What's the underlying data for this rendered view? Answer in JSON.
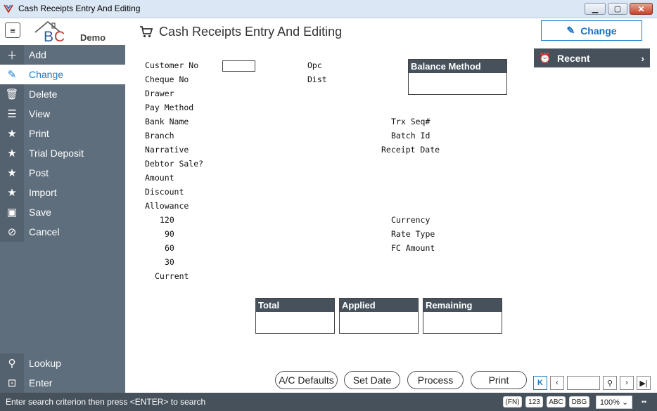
{
  "window": {
    "title": "Cash Receipts Entry And Editing"
  },
  "header": {
    "logo_demo": "Demo",
    "page_title": "Cash Receipts Entry And Editing",
    "mode_button": "Change"
  },
  "sidebar": {
    "items": [
      {
        "label": "Add",
        "icon": "plus-icon"
      },
      {
        "label": "Change",
        "icon": "pencil-icon"
      },
      {
        "label": "Delete",
        "icon": "trash-icon"
      },
      {
        "label": "View",
        "icon": "list-icon"
      },
      {
        "label": "Print",
        "icon": "star-icon"
      },
      {
        "label": "Trial Deposit",
        "icon": "star-icon"
      },
      {
        "label": "Post",
        "icon": "star-icon"
      },
      {
        "label": "Import",
        "icon": "star-icon"
      },
      {
        "label": "Save",
        "icon": "floppy-icon"
      },
      {
        "label": "Cancel",
        "icon": "cancel-icon"
      }
    ],
    "bottom": [
      {
        "label": "Lookup",
        "icon": "search-icon"
      },
      {
        "label": "Enter",
        "icon": "terminal-icon"
      }
    ]
  },
  "form": {
    "left_labels": {
      "customer_no": "Customer No",
      "cheque_no": "Cheque No",
      "drawer": "Drawer",
      "pay_method": "Pay Method",
      "bank_name": "Bank Name",
      "branch": "Branch",
      "narrative": "Narrative",
      "debtor_sale": "Debtor Sale?",
      "amount": "Amount",
      "discount": "Discount",
      "allowance": "Allowance",
      "aging_120": "120",
      "aging_90": "90",
      "aging_60": "60",
      "aging_30": "30",
      "aging_current": "Current"
    },
    "mid_labels": {
      "opc": "Opc",
      "dist": "Dist"
    },
    "right_labels": {
      "trx_seq": "Trx Seq#",
      "batch_id": "Batch Id",
      "receipt_date": "Receipt Date",
      "currency": "Currency",
      "rate_type": "Rate Type",
      "fc_amount": "FC Amount"
    },
    "balance_method": "Balance Method",
    "totals": {
      "total": "Total",
      "applied": "Applied",
      "remaining": "Remaining"
    }
  },
  "recent": {
    "label": "Recent"
  },
  "actions": {
    "ac_defaults": "A/C Defaults",
    "set_date": "Set Date",
    "process": "Process",
    "print": "Print"
  },
  "status": {
    "message": "Enter search criterion then press <ENTER> to search",
    "fn": "(FN)",
    "num": "123",
    "abc": "ABC",
    "dbg": "DBG",
    "zoom": "100%"
  },
  "colors": {
    "accent": "#1a7ccc",
    "sidebar": "#5f6e7c",
    "dark": "#46515c"
  }
}
